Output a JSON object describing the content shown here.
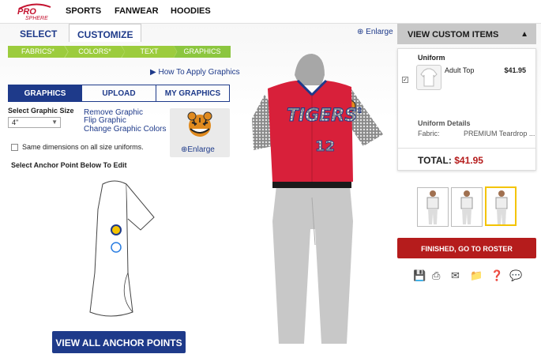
{
  "brand": {
    "logo_top": "PRO",
    "logo_bottom": "SPHERE"
  },
  "nav": [
    "SPORTS",
    "FANWEAR",
    "HOODIES"
  ],
  "tabs": {
    "select": "SELECT",
    "customize": "CUSTOMIZE"
  },
  "steps": [
    "FABRICS*",
    "COLORS*",
    "TEXT",
    "GRAPHICS"
  ],
  "how_to": "How To Apply Graphics",
  "enlarge_top": "Enlarge",
  "graphic_tabs": [
    "GRAPHICS",
    "UPLOAD",
    "MY GRAPHICS"
  ],
  "size_label": "Select Graphic Size",
  "size_value": "4\"",
  "links": [
    "Remove Graphic",
    "Flip Graphic",
    "Change Graphic Colors"
  ],
  "enlarge_graphic": "Enlarge",
  "same_dims": "Same dimensions on all size uniforms.",
  "anchor_label": "Select Anchor Point Below To Edit",
  "view_all_anchor": "VIEW ALL ANCHOR POINTS",
  "jersey": {
    "team": "TIGERS'",
    "number": "12",
    "body_color": "#d8203a",
    "pant_color": "#c8c8c8"
  },
  "panel": {
    "header": "VIEW CUSTOM ITEMS",
    "section": "Uniform",
    "item_name": "Adult Top",
    "item_price": "$41.95",
    "details_title": "Uniform Details",
    "fabric_label": "Fabric:",
    "fabric_value": "PREMIUM Teardrop ...",
    "total_label": "TOTAL:",
    "total_value": "$41.95"
  },
  "finish": "FINISHED, GO TO ROSTER",
  "colors": {
    "navy": "#1e3a8a",
    "green": "#8cc63f",
    "red": "#b51c1c",
    "gold": "#f4c400"
  }
}
